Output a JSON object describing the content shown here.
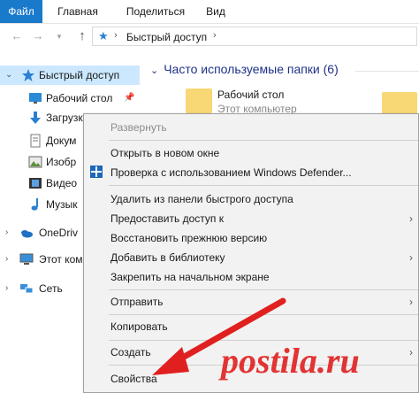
{
  "ribbon": {
    "tabs": [
      "Файл",
      "Главная",
      "Поделиться",
      "Вид"
    ]
  },
  "address": {
    "crumb": "Быстрый доступ"
  },
  "nav": {
    "items": [
      {
        "label": "Быстрый доступ",
        "icon": "star-icon"
      },
      {
        "label": "Рабочий стол",
        "icon": "desktop-icon"
      },
      {
        "label": "Загрузк",
        "icon": "download-icon"
      },
      {
        "label": "Докум",
        "icon": "document-icon"
      },
      {
        "label": "Изобр",
        "icon": "picture-icon"
      },
      {
        "label": "Видео",
        "icon": "video-icon"
      },
      {
        "label": "Музык",
        "icon": "music-icon"
      },
      {
        "label": "OneDriv",
        "icon": "cloud-icon"
      },
      {
        "label": "Этот ком",
        "icon": "computer-icon"
      },
      {
        "label": "Сеть",
        "icon": "network-icon"
      }
    ]
  },
  "content": {
    "group_title": "Часто используемые папки (6)",
    "tile1_name": "Рабочий стол",
    "tile1_sub": "Этот компьютер"
  },
  "context_menu": {
    "items": [
      {
        "label": "Развернуть",
        "disabled": true
      },
      {
        "label": "Открыть в новом окне"
      },
      {
        "label": "Проверка с использованием Windows Defender..."
      },
      {
        "label": "Удалить из панели быстрого доступа"
      },
      {
        "label": "Предоставить доступ к",
        "submenu": true
      },
      {
        "label": "Восстановить прежнюю версию"
      },
      {
        "label": "Добавить в библиотеку",
        "submenu": true
      },
      {
        "label": "Закрепить на начальном экране"
      },
      {
        "label": "Отправить",
        "submenu": true
      },
      {
        "label": "Копировать"
      },
      {
        "label": "Создать",
        "submenu": true
      },
      {
        "label": "Свойства"
      }
    ]
  },
  "watermark": "postila.ru",
  "colors": {
    "accent": "#1979ca",
    "selection": "#cce8ff",
    "arrow": "#e0201f"
  }
}
